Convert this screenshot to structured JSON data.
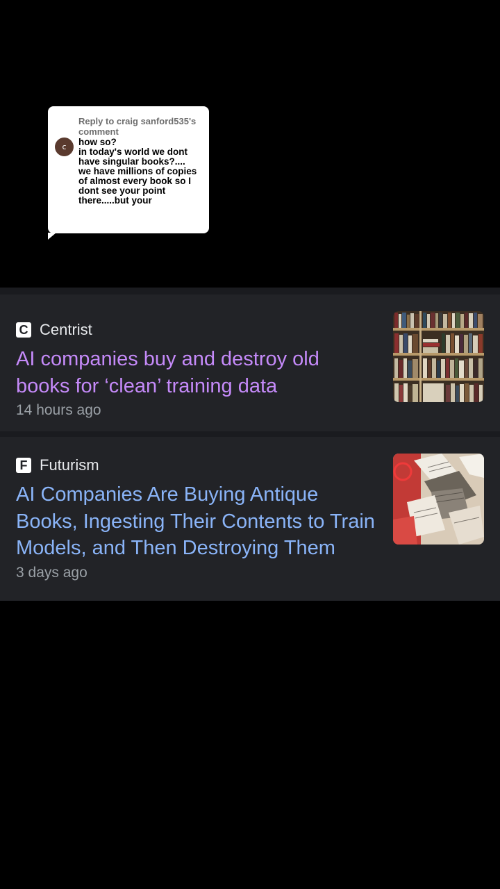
{
  "reply": {
    "header": "Reply to craig sanford535's comment",
    "avatar_initial": "c",
    "body": "how so?\nin today's world we dont have singular books?....\nwe have millions of copies of almost every book so I dont see your point there.....but your"
  },
  "news": {
    "items": [
      {
        "source_logo": "C",
        "source": "Centrist",
        "headline": "AI companies buy and destroy old books for ‘clean’ training data",
        "time": "14 hours ago",
        "thumbnail_icon": "bookshelf-thumbnail",
        "visited": true
      },
      {
        "source_logo": "F",
        "source": "Futurism",
        "headline": "AI Companies Are Buying Antique Books, Ingesting Their Contents to Train Models, and Then Destroying Them",
        "time": "3 days ago",
        "thumbnail_icon": "shredded-paper-thumbnail",
        "visited": false
      }
    ]
  },
  "colors": {
    "page_background": "#000000",
    "card_background": "#222327",
    "visited_link": "#c58af9",
    "unvisited_link": "#8ab4f8",
    "meta_text": "#9aa0a6"
  }
}
